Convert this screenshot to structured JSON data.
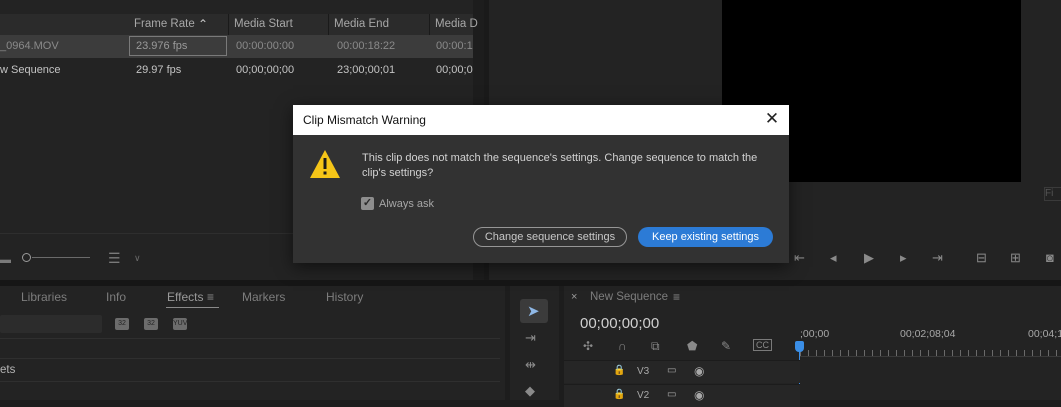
{
  "project_panel": {
    "columns": [
      "Frame Rate",
      "Media Start",
      "Media End",
      "Media D"
    ],
    "rows": [
      {
        "name": "_0964.MOV",
        "frame_rate": "23.976 fps",
        "media_start": "00:00:00:00",
        "media_end": "00:00:18:22",
        "media_duration": "00:00:1"
      },
      {
        "name": "w Sequence",
        "frame_rate": "29.97 fps",
        "media_start": "00;00;00;00",
        "media_end": "23;00;00;01",
        "media_duration": "00;00;0"
      }
    ]
  },
  "monitor": {
    "fit_label": "Fi"
  },
  "bottom_tabs": [
    "Libraries",
    "Info",
    "Effects",
    "Markers",
    "History"
  ],
  "effects_panel": {
    "button_labels": [
      "32",
      "32",
      "YUV"
    ],
    "list_item": "ets"
  },
  "timeline": {
    "tab_label": "New Sequence",
    "timecode": "00;00;00;00",
    "ruler_labels": [
      ";00;00",
      "00;02;08;04",
      "00;04;1"
    ],
    "tracks": [
      "V3",
      "V2"
    ]
  },
  "dialog": {
    "title": "Clip Mismatch Warning",
    "message": "This clip does not match the sequence's settings. Change sequence to match the clip's settings?",
    "checkbox_label": "Always ask",
    "checkbox_checked": true,
    "secondary_button": "Change sequence settings",
    "primary_button": "Keep existing settings"
  },
  "colors": {
    "accent": "#2c7bd6",
    "playhead": "#3a8ee6",
    "warning": "#f5c518"
  }
}
